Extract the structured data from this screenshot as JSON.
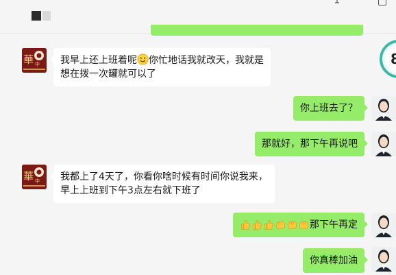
{
  "messages": [
    {
      "side": "left",
      "line1_a": "我早上还上班着呢",
      "emoji": "smile-emoji",
      "line1_b": "你忙地话我就改天，我就是",
      "line2": "想在拨一次罐就可以了"
    },
    {
      "side": "right",
      "text": "你上班去了？"
    },
    {
      "side": "right",
      "text": "那就好，那下午再说吧"
    },
    {
      "side": "left",
      "line1": "我都上了4天了，你看你啥时候有时间你说我来，",
      "line2": "早上上班到下午3点左右就下班了"
    },
    {
      "side": "right",
      "emojis": [
        "thumbs-up",
        "thumbs-up",
        "thumbs-up",
        "fist",
        "fist",
        "fist"
      ],
      "text": "那下午再定"
    },
    {
      "side": "right",
      "text": "你真棒加油"
    }
  ],
  "side_widget": {
    "digit": "8"
  },
  "colors": {
    "right_bubble": "#95ec69",
    "left_bubble": "#ffffff",
    "background": "#f5f5f5"
  }
}
